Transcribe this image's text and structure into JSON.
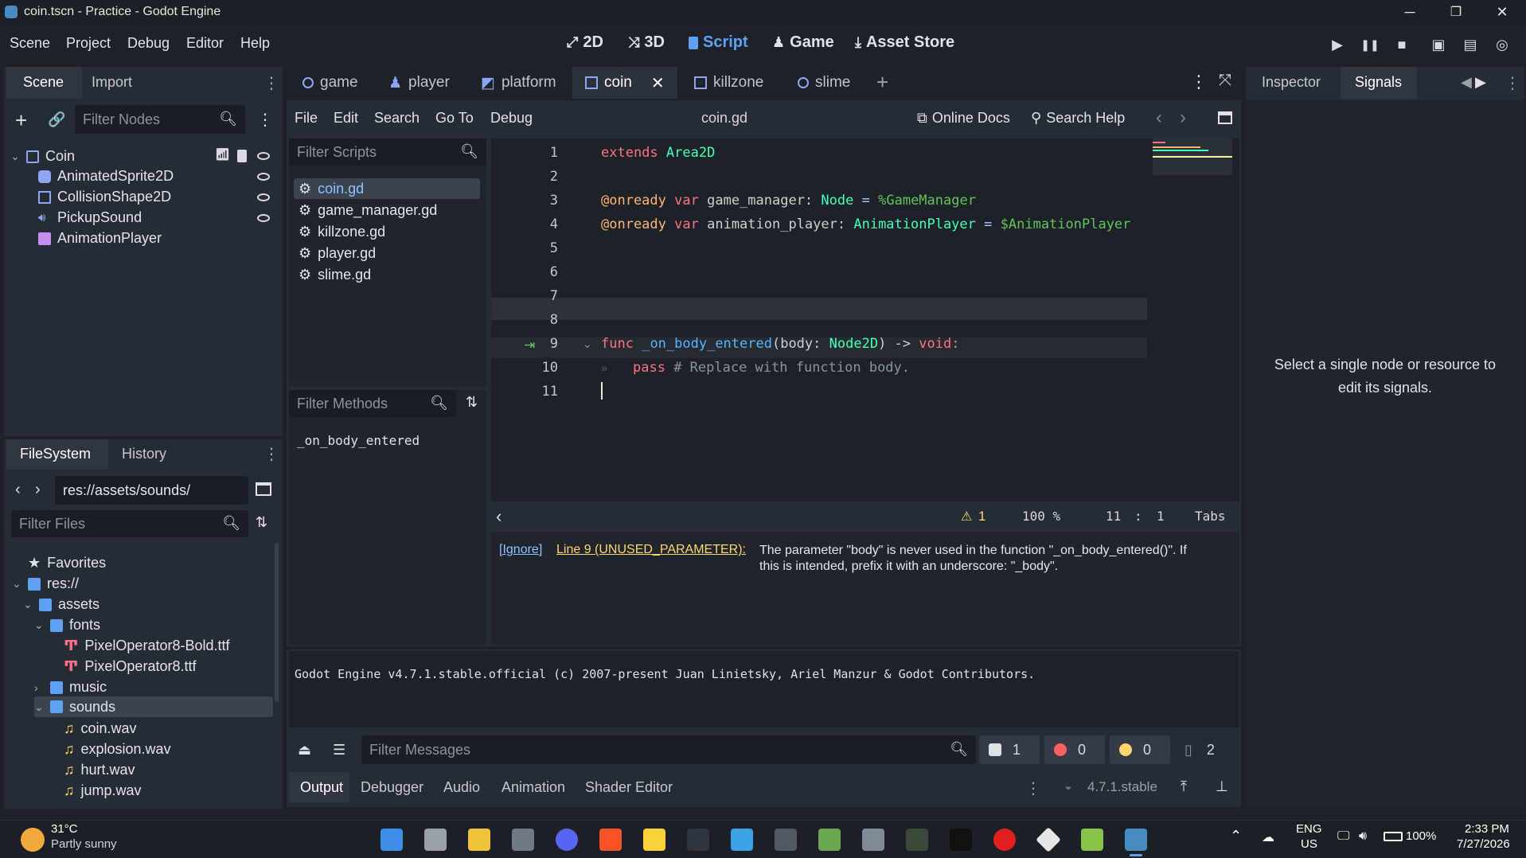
{
  "window": {
    "title": "coin.tscn - Practice - Godot Engine",
    "controls": [
      "─",
      "❐",
      "✕"
    ]
  },
  "menu": {
    "items": [
      "Scene",
      "Project",
      "Debug",
      "Editor",
      "Help"
    ],
    "workspaces": [
      {
        "label": "2D",
        "icon": "2d-icon"
      },
      {
        "label": "3D",
        "icon": "3d-icon"
      },
      {
        "label": "Script",
        "icon": "script-icon",
        "active": true
      },
      {
        "label": "Game",
        "icon": "game-icon"
      },
      {
        "label": "Asset Store",
        "icon": "asset-store-icon"
      }
    ]
  },
  "scene_dock": {
    "tabs": [
      "Scene",
      "Import"
    ],
    "filter_placeholder": "Filter Nodes",
    "nodes": [
      {
        "label": "Coin",
        "icon": "area2d-icon",
        "color": "#8da5f3"
      },
      {
        "label": "AnimatedSprite2D",
        "icon": "animated-sprite-icon",
        "color": "#8da5f3"
      },
      {
        "label": "CollisionShape2D",
        "icon": "collision-shape-icon",
        "color": "#8da5f3"
      },
      {
        "label": "PickupSound",
        "icon": "audio-player-icon",
        "color": "#8da5f3"
      },
      {
        "label": "AnimationPlayer",
        "icon": "animation-player-icon",
        "color": "#c38ef1"
      }
    ]
  },
  "filesystem_dock": {
    "tabs": [
      "FileSystem",
      "History"
    ],
    "path": "res://assets/sounds/",
    "filter_placeholder": "Filter Files",
    "items": [
      {
        "label": "Favorites",
        "icon": "star-icon"
      },
      {
        "label": "res://",
        "icon": "folder-icon"
      },
      {
        "label": "assets",
        "icon": "folder-icon"
      },
      {
        "label": "fonts",
        "icon": "folder-icon"
      },
      {
        "label": "PixelOperator8-Bold.ttf",
        "icon": "font-file-icon"
      },
      {
        "label": "PixelOperator8.ttf",
        "icon": "font-file-icon"
      },
      {
        "label": "music",
        "icon": "folder-icon"
      },
      {
        "label": "sounds",
        "icon": "folder-icon"
      },
      {
        "label": "coin.wav",
        "icon": "audio-file-icon"
      },
      {
        "label": "explosion.wav",
        "icon": "audio-file-icon"
      },
      {
        "label": "hurt.wav",
        "icon": "audio-file-icon"
      },
      {
        "label": "jump.wav",
        "icon": "audio-file-icon"
      }
    ]
  },
  "scene_tabs": [
    {
      "label": "game",
      "icon": "node2d-icon"
    },
    {
      "label": "player",
      "icon": "character-icon"
    },
    {
      "label": "platform",
      "icon": "platform-icon"
    },
    {
      "label": "coin",
      "icon": "area2d-icon",
      "active": true
    },
    {
      "label": "killzone",
      "icon": "area2d-icon"
    },
    {
      "label": "slime",
      "icon": "node2d-icon"
    }
  ],
  "script_editor": {
    "menu": [
      "File",
      "Edit",
      "Search",
      "Go To",
      "Debug"
    ],
    "current_file": "coin.gd",
    "online_docs": "Online Docs",
    "search_help": "Search Help",
    "filter_scripts_placeholder": "Filter Scripts",
    "scripts": [
      "coin.gd",
      "game_manager.gd",
      "killzone.gd",
      "player.gd",
      "slime.gd"
    ],
    "filter_methods_placeholder": "Filter Methods",
    "methods": [
      "_on_body_entered"
    ],
    "line_numbers": [
      "1",
      "2",
      "3",
      "4",
      "5",
      "6",
      "7",
      "8",
      "9",
      "10",
      "11"
    ],
    "status": {
      "warnings": "1",
      "zoom": "100 %",
      "line": "11",
      "sep": ":",
      "col": "1",
      "indent": "Tabs"
    },
    "warning": {
      "ignore": "[Ignore]",
      "link": "Line 9 (UNUSED_PARAMETER):",
      "text": "The parameter \"body\" is never used in the function \"_on_body_entered()\". If this is intended, prefix it with an underscore: \"_body\"."
    }
  },
  "code": {
    "line1": {
      "kw": "extends",
      "ty": "Area2D"
    },
    "line3": {
      "ann": "@onready",
      "kw": "var",
      "name": "game_manager:",
      "ty": "Node",
      "eq": "=",
      "val": "%GameManager"
    },
    "line4": {
      "ann": "@onready",
      "kw": "var",
      "name": "animation_player:",
      "ty": "AnimationPlayer",
      "eq": "=",
      "val": "$AnimationPlayer"
    },
    "line9": {
      "kw": "func",
      "fn": "_on_body_entered",
      "args": "(body:",
      "ty": "Node2D",
      "rest": ") ->",
      "ret": "void:"
    },
    "line10": {
      "kw": "pass",
      "cm": "# Replace with function body."
    }
  },
  "output": {
    "log": "Godot Engine v4.7.1.stable.official (c) 2007-present Juan Linietsky, Ariel Manzur & Godot Contributors.",
    "filter_placeholder": "Filter Messages",
    "counts": {
      "info": "1",
      "errors": "0",
      "warnings": "0",
      "messages": "2"
    },
    "bottom_tabs": [
      "Output",
      "Debugger",
      "Audio",
      "Animation",
      "Shader Editor"
    ],
    "version": "4.7.1.stable"
  },
  "inspector": {
    "tabs": [
      "Inspector",
      "Signals"
    ],
    "message": "Select a single node or resource to edit its signals."
  },
  "taskbar": {
    "weather_temp": "31°C",
    "weather_desc": "Partly sunny",
    "lang": "ENG",
    "region": "US",
    "battery": "100%",
    "time": "2:33 PM",
    "date": "7/27/2026"
  },
  "colors": {
    "accent": "#5ea0f2",
    "keyword": "#ff7085",
    "type": "#42ffc2",
    "function": "#57b3ff",
    "annotation": "#ffb373",
    "node_path": "#63c259"
  }
}
